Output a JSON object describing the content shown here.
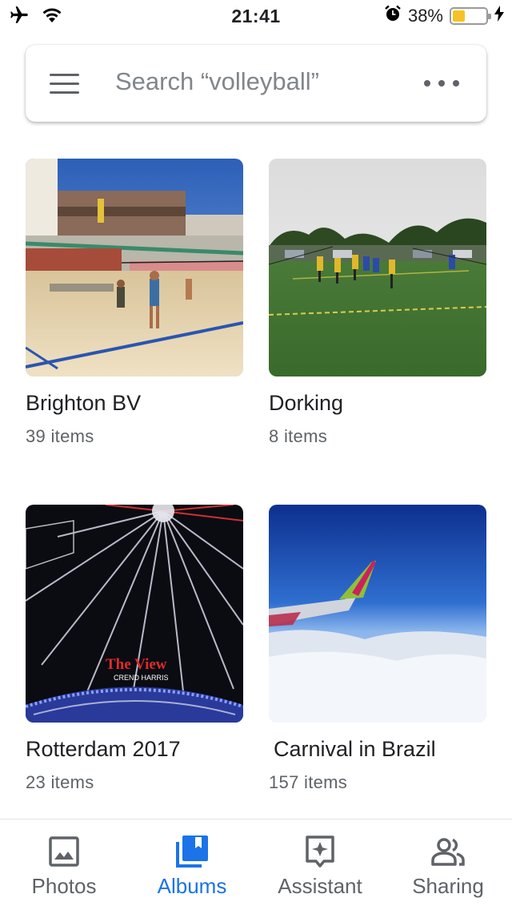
{
  "status_bar": {
    "time": "21:41",
    "battery_percent": "38%",
    "battery_level": 0.38,
    "icons": [
      "airplane-icon",
      "wifi-icon",
      "alarm-icon",
      "battery-icon",
      "charging-bolt-icon"
    ]
  },
  "search": {
    "placeholder": "Search “volleyball”",
    "menu_icon": "hamburger-menu-icon",
    "more_icon": "more-options-icon"
  },
  "albums": [
    {
      "name": "Brighton BV",
      "count": "39 items"
    },
    {
      "name": "Dorking",
      "count": "8 items"
    },
    {
      "name": "Rotterdam 2017",
      "count": "23 items"
    },
    {
      "name": "Carnival in Brazil",
      "count": "157 items"
    }
  ],
  "photo_text": {
    "rotterdam_sign": "The View",
    "rotterdam_sign_sub": "CREND HARRIS"
  },
  "bottom_nav": {
    "items": [
      {
        "label": "Photos",
        "icon": "photo-icon",
        "active": false
      },
      {
        "label": "Albums",
        "icon": "albums-icon",
        "active": true
      },
      {
        "label": "Assistant",
        "icon": "assistant-icon",
        "active": false
      },
      {
        "label": "Sharing",
        "icon": "people-icon",
        "active": false
      }
    ],
    "active_color": "#1a73e8",
    "inactive_color": "#5f6368"
  }
}
